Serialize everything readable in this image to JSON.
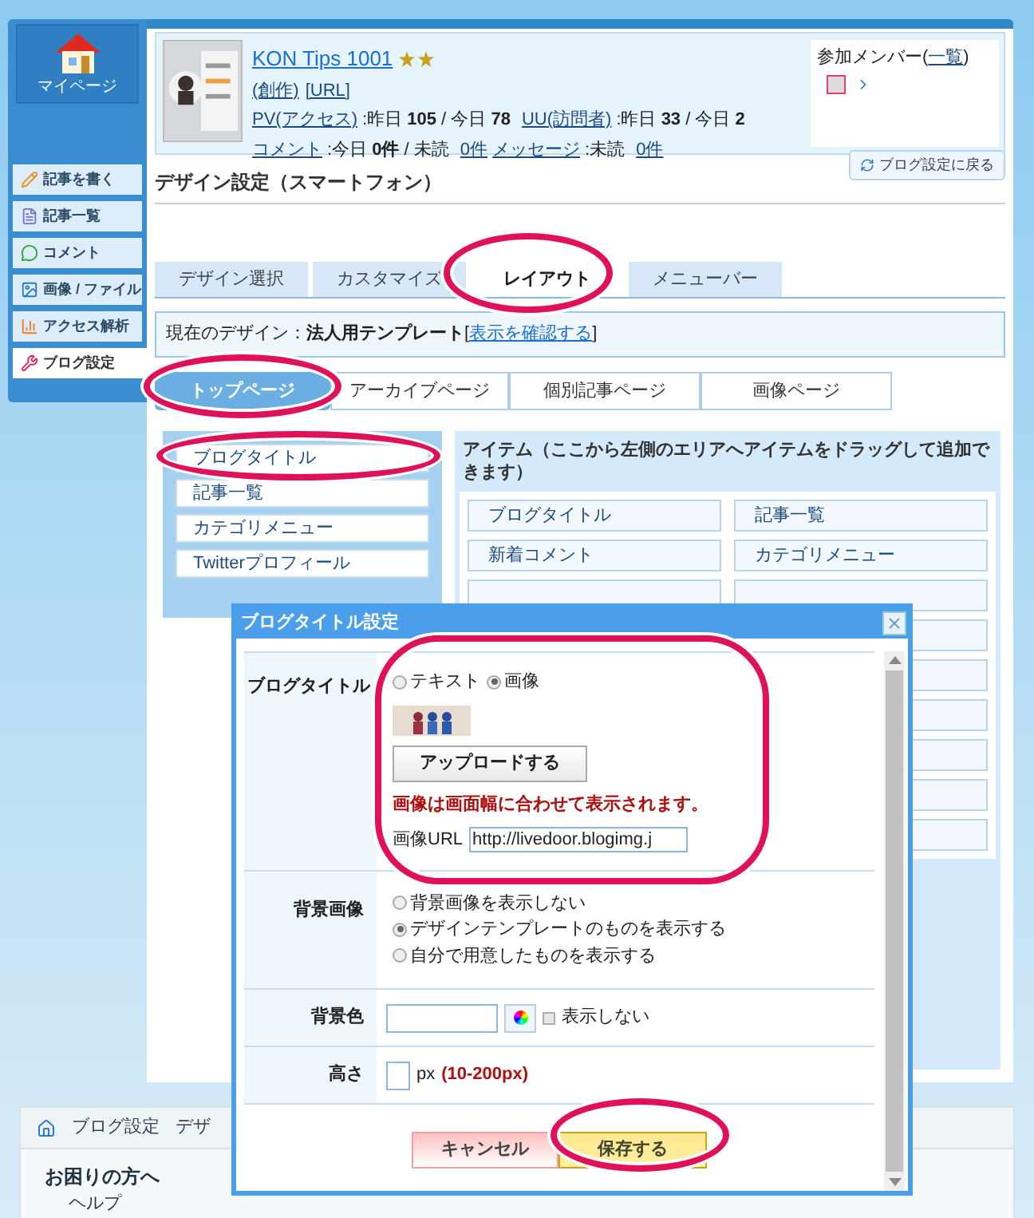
{
  "sidebar": {
    "home": "マイページ",
    "items": [
      {
        "label": "記事を書く",
        "selected": false
      },
      {
        "label": "記事一覧",
        "selected": false
      },
      {
        "label": "コメント",
        "selected": false
      },
      {
        "label": "画像 / ファイル",
        "selected": false
      },
      {
        "label": "アクセス解析",
        "selected": false
      },
      {
        "label": "ブログ設定",
        "selected": true
      }
    ]
  },
  "blog": {
    "title": "KON Tips 1001",
    "links": [
      "(創作)",
      "[URL]"
    ],
    "stats": [
      [
        {
          "kind": "link",
          "text": "PV(アクセス)"
        },
        {
          "kind": "text",
          "text": ":昨日 **105** / 今日 **78**"
        },
        {
          "kind": "link",
          "text": "UU(訪問者)"
        },
        {
          "kind": "text",
          "text": ":昨日 **33** / 今日 **2**"
        }
      ],
      [
        {
          "kind": "link",
          "text": "コメント"
        },
        {
          "kind": "text",
          "text": ":今日 **0件** / 未読"
        },
        {
          "kind": "link",
          "text": "0件"
        },
        {
          "kind": "link",
          "text": "メッセージ"
        },
        {
          "kind": "text",
          "text": ":未読"
        },
        {
          "kind": "link",
          "text": "0件"
        }
      ]
    ],
    "members": {
      "prefix": "参加メンバー(",
      "link": "一覧",
      "suffix": ")"
    }
  },
  "page": {
    "title": "デザイン設定（スマートフォン）",
    "back_button": "ブログ設定に戻る"
  },
  "tabs": [
    {
      "label": "デザイン選択",
      "selected": false
    },
    {
      "label": "カスタマイズ",
      "selected": false
    },
    {
      "label": "レイアウト",
      "selected": true
    },
    {
      "label": "メニューバー",
      "selected": false
    }
  ],
  "current_design": {
    "prefix": "現在のデザイン：**法人用テンプレート**[",
    "link": "表示を確認する",
    "suffix": "]"
  },
  "subtabs": [
    {
      "label": "トップページ",
      "selected": true
    },
    {
      "label": "アーカイブページ",
      "selected": false
    },
    {
      "label": "個別記事ページ",
      "selected": false
    },
    {
      "label": "画像ページ",
      "selected": false
    }
  ],
  "layout_items": [
    "ブログタイトル",
    "記事一覧",
    "カテゴリメニュー",
    "Twitterプロフィール"
  ],
  "available": {
    "heading": "アイテム（ここから左側のエリアへアイテムをドラッグして追加できます）",
    "items": [
      "ブログタイトル",
      "記事一覧",
      "新着コメント",
      "カテゴリメニュー"
    ]
  },
  "footer": {
    "breadcrumb": [
      "ブログ設定",
      "デザ"
    ],
    "heading": "お困りの方へ",
    "links": [
      "ヘルプ"
    ]
  },
  "dialog": {
    "title": "ブログタイトル設定",
    "title_row": {
      "label": "ブログタイトル",
      "options": [
        {
          "label": "テキスト",
          "selected": false
        },
        {
          "label": "画像",
          "selected": true
        }
      ],
      "upload": "アップロードする",
      "note": "画像は画面幅に合わせて表示されます。",
      "url_label": "画像URL",
      "url_value": "http://livedoor.blogimg.j"
    },
    "background_row": {
      "label": "背景画像",
      "options": [
        {
          "label": "背景画像を表示しない",
          "selected": false
        },
        {
          "label": "デザインテンプレートのものを表示する",
          "selected": true
        },
        {
          "label": "自分で用意したものを表示する",
          "selected": false
        }
      ]
    },
    "color_row": {
      "label": "背景色",
      "hide_label": "表示しない",
      "checked": false
    },
    "height_row": {
      "label": "高さ",
      "unit": "px",
      "range": "(10-200px)"
    },
    "cancel": "キャンセル",
    "save": "保存する"
  }
}
